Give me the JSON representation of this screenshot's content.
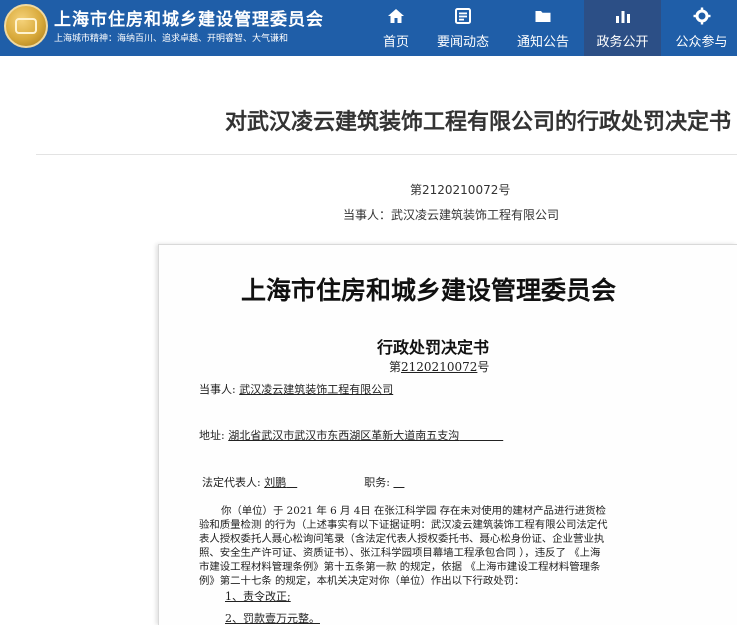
{
  "header": {
    "site_title": "上海市住房和城乡建设管理委员会",
    "motto": "上海城市精神：海纳百川、追求卓越、开明睿智、大气谦和",
    "nav": [
      {
        "label": "首页",
        "icon": "home-icon"
      },
      {
        "label": "要闻动态",
        "icon": "news-icon"
      },
      {
        "label": "通知公告",
        "icon": "folder-icon"
      },
      {
        "label": "政务公开",
        "icon": "bar-chart-icon",
        "active": true
      },
      {
        "label": "公众参与",
        "icon": "gear-icon"
      }
    ]
  },
  "colors": {
    "header_bg": "#1f5ea8",
    "nav_active_bg": "#2c4f86"
  },
  "doc": {
    "title": "对武汉凌云建筑装饰工程有限公司的行政处罚决定书",
    "number": "第2120210072号",
    "party": "当事人：武汉凌云建筑装饰工程有限公司"
  },
  "scan": {
    "org": "上海市住房和城乡建设管理委员会",
    "title": "行政处罚决定书",
    "number_prefix": "第",
    "number": "2120210072",
    "number_suffix": "号",
    "party_label": "当事人:",
    "party_value": "武汉凌云建筑装饰工程有限公司",
    "address_label": "地址:",
    "address_value": "湖北省武汉市武汉市东西湖区革新大道南五支沟",
    "legal_rep_label": "法定代表人:",
    "legal_rep_value": "刘鹏",
    "position_label": "职务:",
    "position_value": "",
    "paragraph_lines": [
      "你（单位）于 2021 年 6 月 4日 在张江科学园 存在未对使用的建材产品进行进货检",
      "验和质量检测 的行为（上述事实有以下证据证明：武汉凌云建筑装饰工程有限公司法定代",
      "表人授权委托人聂心松询问笔录（含法定代表人授权委托书、聂心松身份证、企业营业执",
      "照、安全生产许可证、资质证书）、张江科学园项目幕墙工程承包合同 ），违反了 《上海",
      "市建设工程材料管理条例》第十五条第一款 的规定，依据 《上海市建设工程材料管理条",
      "例》第二十七条 的规定，本机关决定对你（单位）作出以下行政处罚："
    ],
    "items": [
      "1、责令改正;",
      "2、罚款壹万元整。"
    ]
  }
}
